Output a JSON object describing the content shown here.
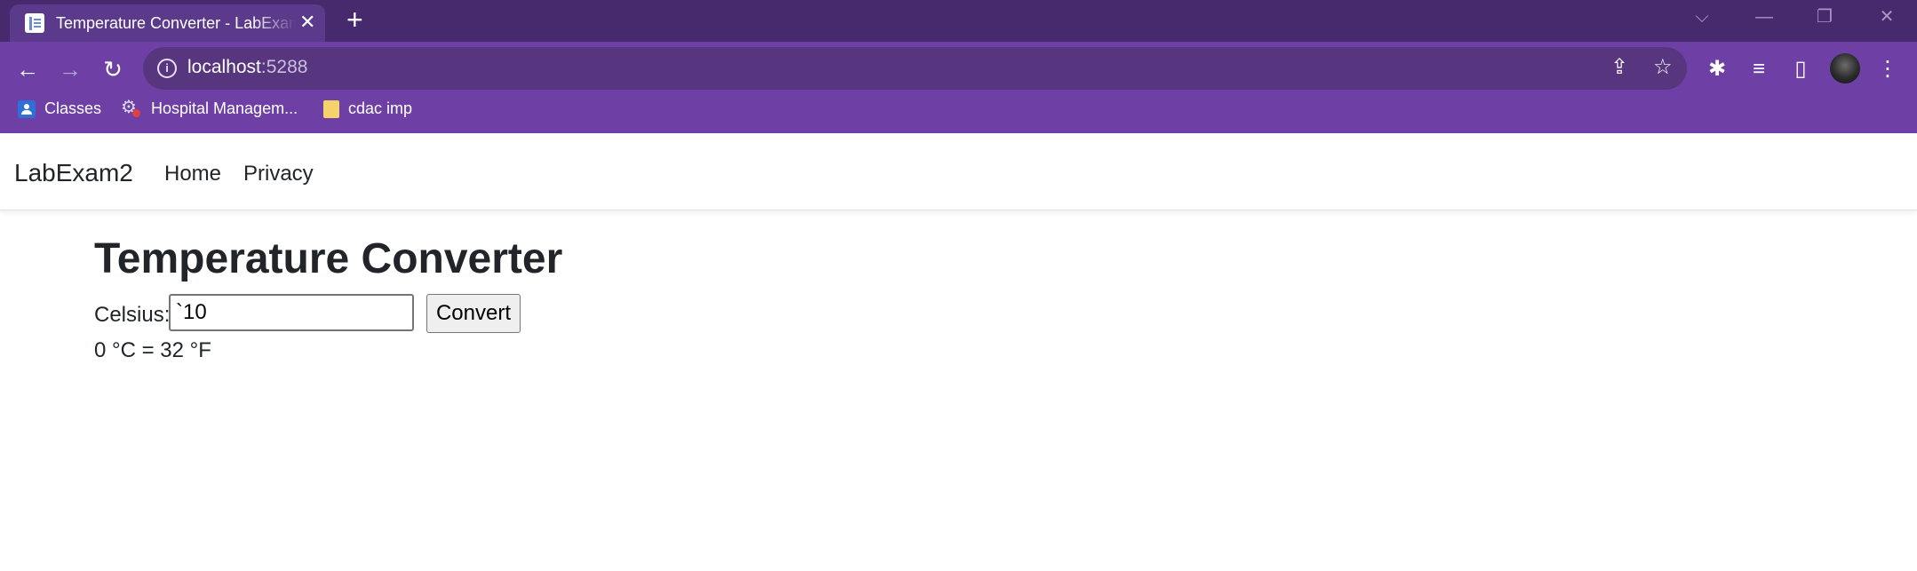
{
  "browser": {
    "tab": {
      "title": "Temperature Converter - LabExam2",
      "close": "✕"
    },
    "new_tab": "+",
    "window_controls": {
      "chevron": "⌵",
      "minimize": "—",
      "restore": "❐",
      "close": "✕"
    },
    "address": {
      "host": "localhost",
      "port": ":5288"
    },
    "icons": {
      "back": "←",
      "forward": "→",
      "reload": "↻",
      "info": "i",
      "share": "⇪",
      "star": "☆",
      "extensions": "✱",
      "media": "≡",
      "sidepanel": "▯",
      "menu": "⋮"
    },
    "bookmarks": [
      {
        "label": "Classes",
        "icon": "user-icon"
      },
      {
        "label": "Hospital Managem...",
        "icon": "gear-icon"
      },
      {
        "label": "cdac imp",
        "icon": "folder-icon"
      }
    ]
  },
  "app": {
    "brand": "LabExam2",
    "nav": [
      {
        "label": "Home"
      },
      {
        "label": "Privacy"
      }
    ]
  },
  "converter": {
    "title": "Temperature Converter",
    "celsius_label": "Celsius:",
    "celsius_value": "`10",
    "convert_label": "Convert",
    "result": "0 °C = 32 °F"
  }
}
